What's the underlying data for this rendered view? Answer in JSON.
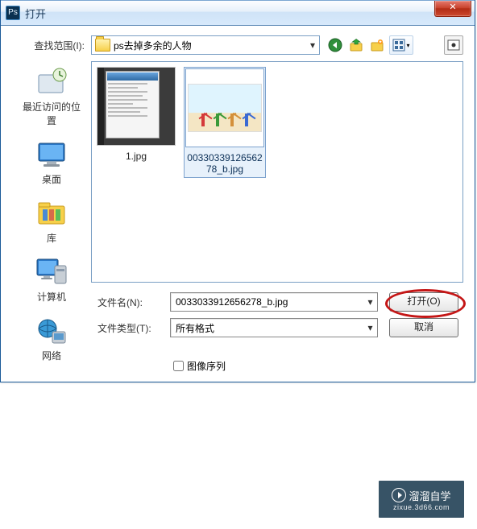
{
  "window": {
    "title": "打开",
    "close_glyph": "✕"
  },
  "lookin": {
    "label": "查找范围(I):",
    "value": "ps去掉多余的人物"
  },
  "toolbar": {
    "back": "back-icon",
    "up": "up-icon",
    "new_folder": "new-folder-icon",
    "views": "views-icon",
    "extra": "extra-icon"
  },
  "places": [
    {
      "label": "最近访问的位置",
      "icon": "recent"
    },
    {
      "label": "桌面",
      "icon": "desktop"
    },
    {
      "label": "库",
      "icon": "library"
    },
    {
      "label": "计算机",
      "icon": "computer"
    },
    {
      "label": "网络",
      "icon": "network"
    }
  ],
  "files": [
    {
      "name": "1.jpg",
      "selected": false
    },
    {
      "name": "00330339126562",
      "name2": "78_b.jpg",
      "selected": true
    }
  ],
  "filename": {
    "label": "文件名(N):",
    "value": "0033033912656278_b.jpg"
  },
  "filetype": {
    "label": "文件类型(T):",
    "value": "所有格式"
  },
  "buttons": {
    "open": "打开(O)",
    "cancel": "取消"
  },
  "sequence": {
    "label": "图像序列",
    "checked": false
  },
  "watermark": {
    "line1": "溜溜自学",
    "line2": "zixue.3d66.com"
  }
}
